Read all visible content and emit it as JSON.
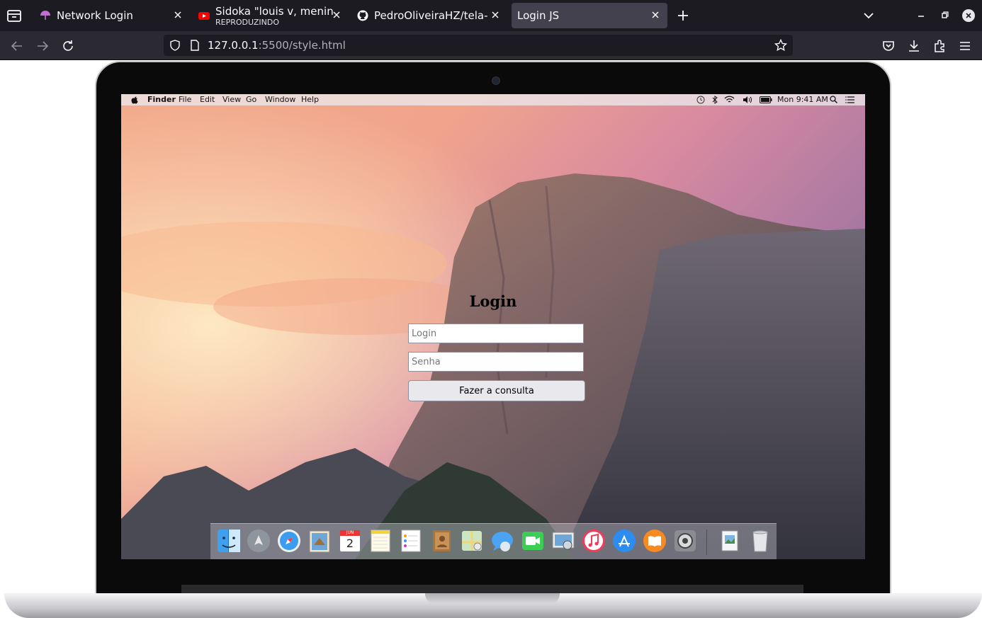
{
  "browser": {
    "tabs": [
      {
        "title": "Network Login",
        "subtitle": "",
        "icon": "umbrella-icon",
        "active": false
      },
      {
        "title": "Sidoka \"louis v, menina lin",
        "subtitle": "REPRODUZINDO",
        "icon": "youtube-icon",
        "active": false
      },
      {
        "title": "PedroOliveiraHZ/tela-de-",
        "subtitle": "",
        "icon": "github-icon",
        "active": false
      },
      {
        "title": "Login JS",
        "subtitle": "",
        "icon": "",
        "active": true
      }
    ],
    "url_host": "127.0.0.1",
    "url_rest": ":5500/style.html"
  },
  "mac": {
    "menu_left": [
      "Finder",
      "File",
      "Edit",
      "View",
      "Go",
      "Window",
      "Help"
    ],
    "clock": "Mon 9:41 AM",
    "calendar_month": "JUN",
    "calendar_day": "2"
  },
  "login": {
    "title": "Login",
    "login_placeholder": "Login",
    "password_placeholder": "Senha",
    "submit_label": "Fazer a consulta"
  },
  "colors": {
    "browser_dark": "#1c1b22",
    "toolbar": "#2b2a33",
    "active_tab": "#42414d"
  }
}
